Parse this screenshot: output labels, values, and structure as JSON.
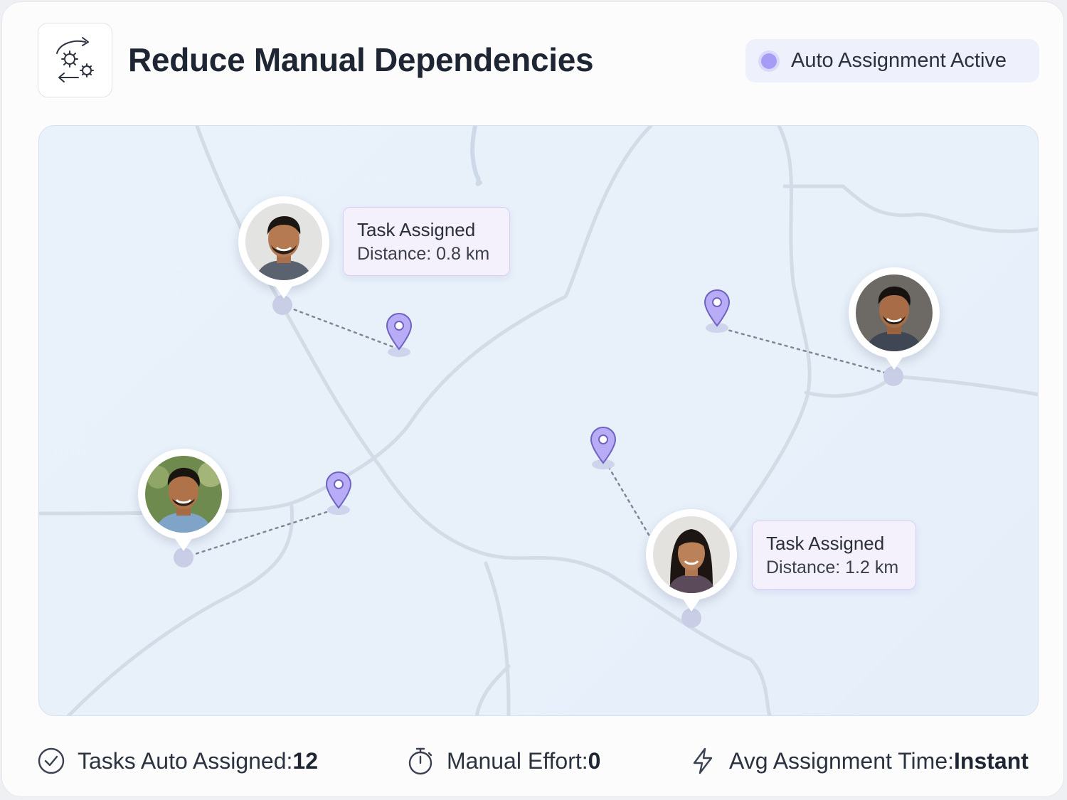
{
  "header": {
    "title": "Reduce Manual Dependencies",
    "logo_icon": "gears-sync-icon",
    "status": {
      "text": "Auto Assignment Active",
      "dot_color": "#a79cf5"
    }
  },
  "map": {
    "accent_color": "#a99cf0",
    "assignments": [
      {
        "tooltip_title": "Task Assigned",
        "tooltip_distance": "Distance: 0.8 km"
      },
      {
        "tooltip_title": "Task Assigned",
        "tooltip_distance": "Distance: 1.2 km"
      }
    ]
  },
  "stats": [
    {
      "icon": "check-circle-icon",
      "label": "Tasks Auto Assigned: ",
      "value": "12"
    },
    {
      "icon": "stopwatch-icon",
      "label": "Manual Effort: ",
      "value": "0"
    },
    {
      "icon": "lightning-icon",
      "label": "Avg Assignment Time: ",
      "value": "Instant"
    }
  ]
}
